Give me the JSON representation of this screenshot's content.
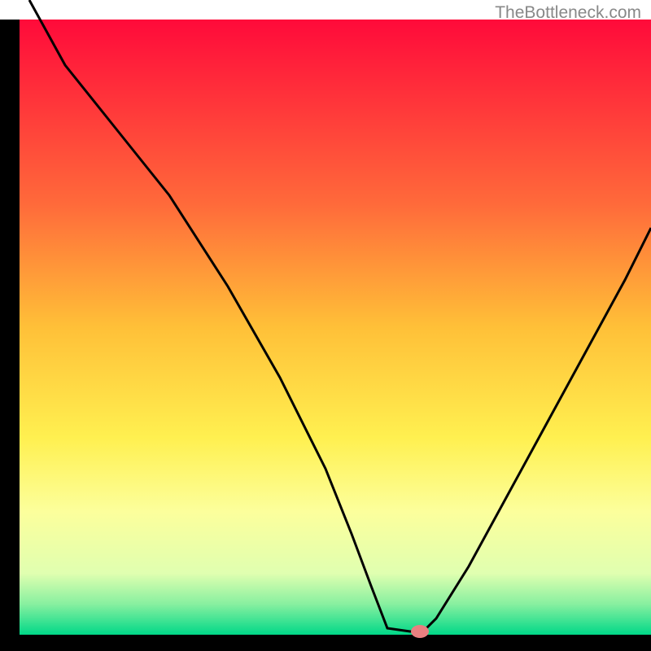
{
  "watermark": "TheBottleneck.com",
  "chart_data": {
    "type": "line",
    "title": "",
    "xlabel": "",
    "ylabel": "",
    "xlim": [
      0,
      100
    ],
    "ylim": [
      0,
      100
    ],
    "border_left_x": 3,
    "border_right_x": 100,
    "border_top_y": 3,
    "border_bottom_y": 97.5,
    "gradient_stops": [
      {
        "offset": 0,
        "color": "#ff0a3a"
      },
      {
        "offset": 30,
        "color": "#ff6a3a"
      },
      {
        "offset": 50,
        "color": "#ffc038"
      },
      {
        "offset": 68,
        "color": "#fff050"
      },
      {
        "offset": 80,
        "color": "#fcff9c"
      },
      {
        "offset": 90,
        "color": "#e0ffb0"
      },
      {
        "offset": 95,
        "color": "#88f0a0"
      },
      {
        "offset": 100,
        "color": "#00d888"
      }
    ],
    "curve_points": [
      {
        "x": 4.5,
        "y": 0
      },
      {
        "x": 10,
        "y": 10
      },
      {
        "x": 18,
        "y": 20
      },
      {
        "x": 26,
        "y": 30
      },
      {
        "x": 35,
        "y": 44
      },
      {
        "x": 43,
        "y": 58
      },
      {
        "x": 50,
        "y": 72
      },
      {
        "x": 54,
        "y": 82
      },
      {
        "x": 57,
        "y": 90
      },
      {
        "x": 59.5,
        "y": 96.5
      },
      {
        "x": 63,
        "y": 97
      },
      {
        "x": 65,
        "y": 97
      },
      {
        "x": 67,
        "y": 95
      },
      {
        "x": 72,
        "y": 87
      },
      {
        "x": 78,
        "y": 76
      },
      {
        "x": 84,
        "y": 65
      },
      {
        "x": 90,
        "y": 54
      },
      {
        "x": 96,
        "y": 43
      },
      {
        "x": 100,
        "y": 35
      }
    ],
    "marker": {
      "x": 64.5,
      "y": 97,
      "color": "#e88080"
    }
  }
}
